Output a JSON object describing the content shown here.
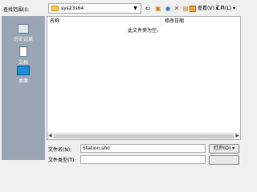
{
  "toolbar": {
    "look_in_label": "查找范围(I):",
    "folder_name": "sys23s64",
    "view_label": "查看(V)",
    "tools_label": "工具(L)",
    "back_icon": "back-arrow-icon",
    "up_icon": "up-folder-icon",
    "search_icon": "search-web-icon",
    "delete_icon": "delete-icon",
    "new_folder_icon": "new-folder-icon"
  },
  "places": [
    {
      "label": "历史记录",
      "icon": "history-icon"
    },
    {
      "label": "文档",
      "icon": "documents-icon"
    },
    {
      "label": "桌面",
      "icon": "desktop-icon"
    }
  ],
  "filelist": {
    "columns": [
      "名称",
      "修改日期"
    ],
    "empty_message": "此文件夹为空。"
  },
  "footer": {
    "filename_label": "文件名(N):",
    "filename_value": "Station.sho",
    "open_label": "打开(O)",
    "filetype_label": "文件类型(T):"
  }
}
